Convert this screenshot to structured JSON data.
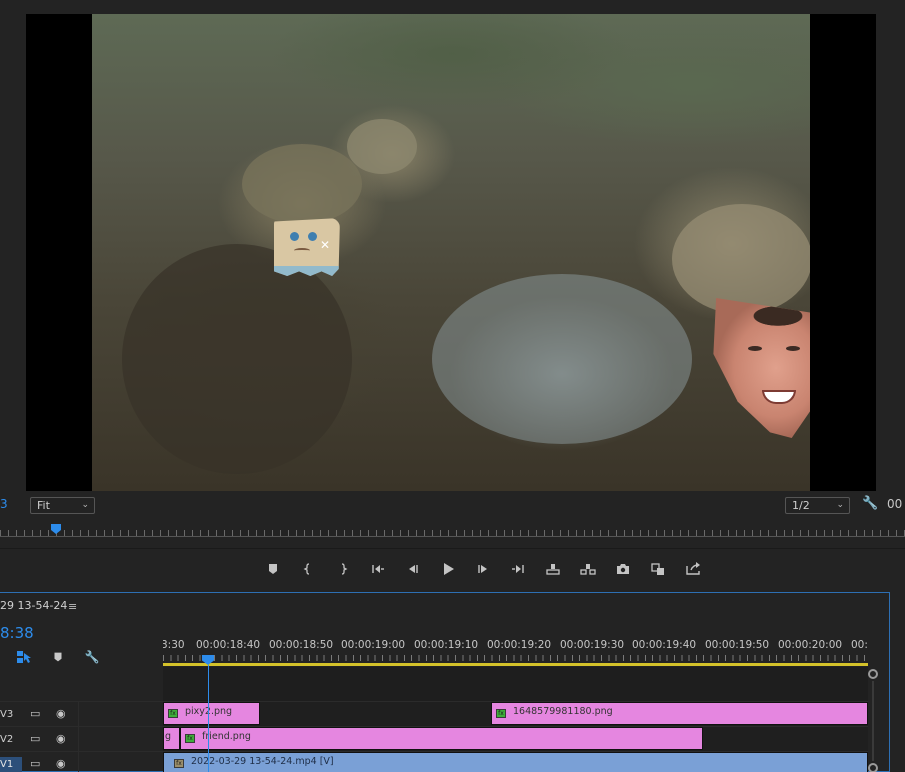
{
  "monitor": {
    "left_number": "3",
    "zoom_select": "Fit",
    "resolution_select": "1/2",
    "right_timecode": "00"
  },
  "sequence": {
    "name": "29 13-54-24",
    "timecode": "8:38"
  },
  "ruler": {
    "labels": [
      "3:30",
      "00:00:18:40",
      "00:00:18:50",
      "00:00:19:00",
      "00:00:19:10",
      "00:00:19:20",
      "00:00:19:30",
      "00:00:19:40",
      "00:00:19:50",
      "00:00:20:00",
      "00:0"
    ]
  },
  "tracks": [
    {
      "name": "V3",
      "active": false
    },
    {
      "name": "V2",
      "active": false
    },
    {
      "name": "V1",
      "active": true
    }
  ],
  "clips": {
    "v3_a": "pixy2.png",
    "v3_b": "1648579981180.png",
    "v2_a": "g",
    "v2_b": "friend.png",
    "v1_a": "2022-03-29 13-54-24.mp4 [V]"
  },
  "colors": {
    "accent": "#2d8ceb",
    "graphic_clip": "#e586e0",
    "video_clip": "#7aa0d6",
    "work_area": "#d4c22a"
  }
}
